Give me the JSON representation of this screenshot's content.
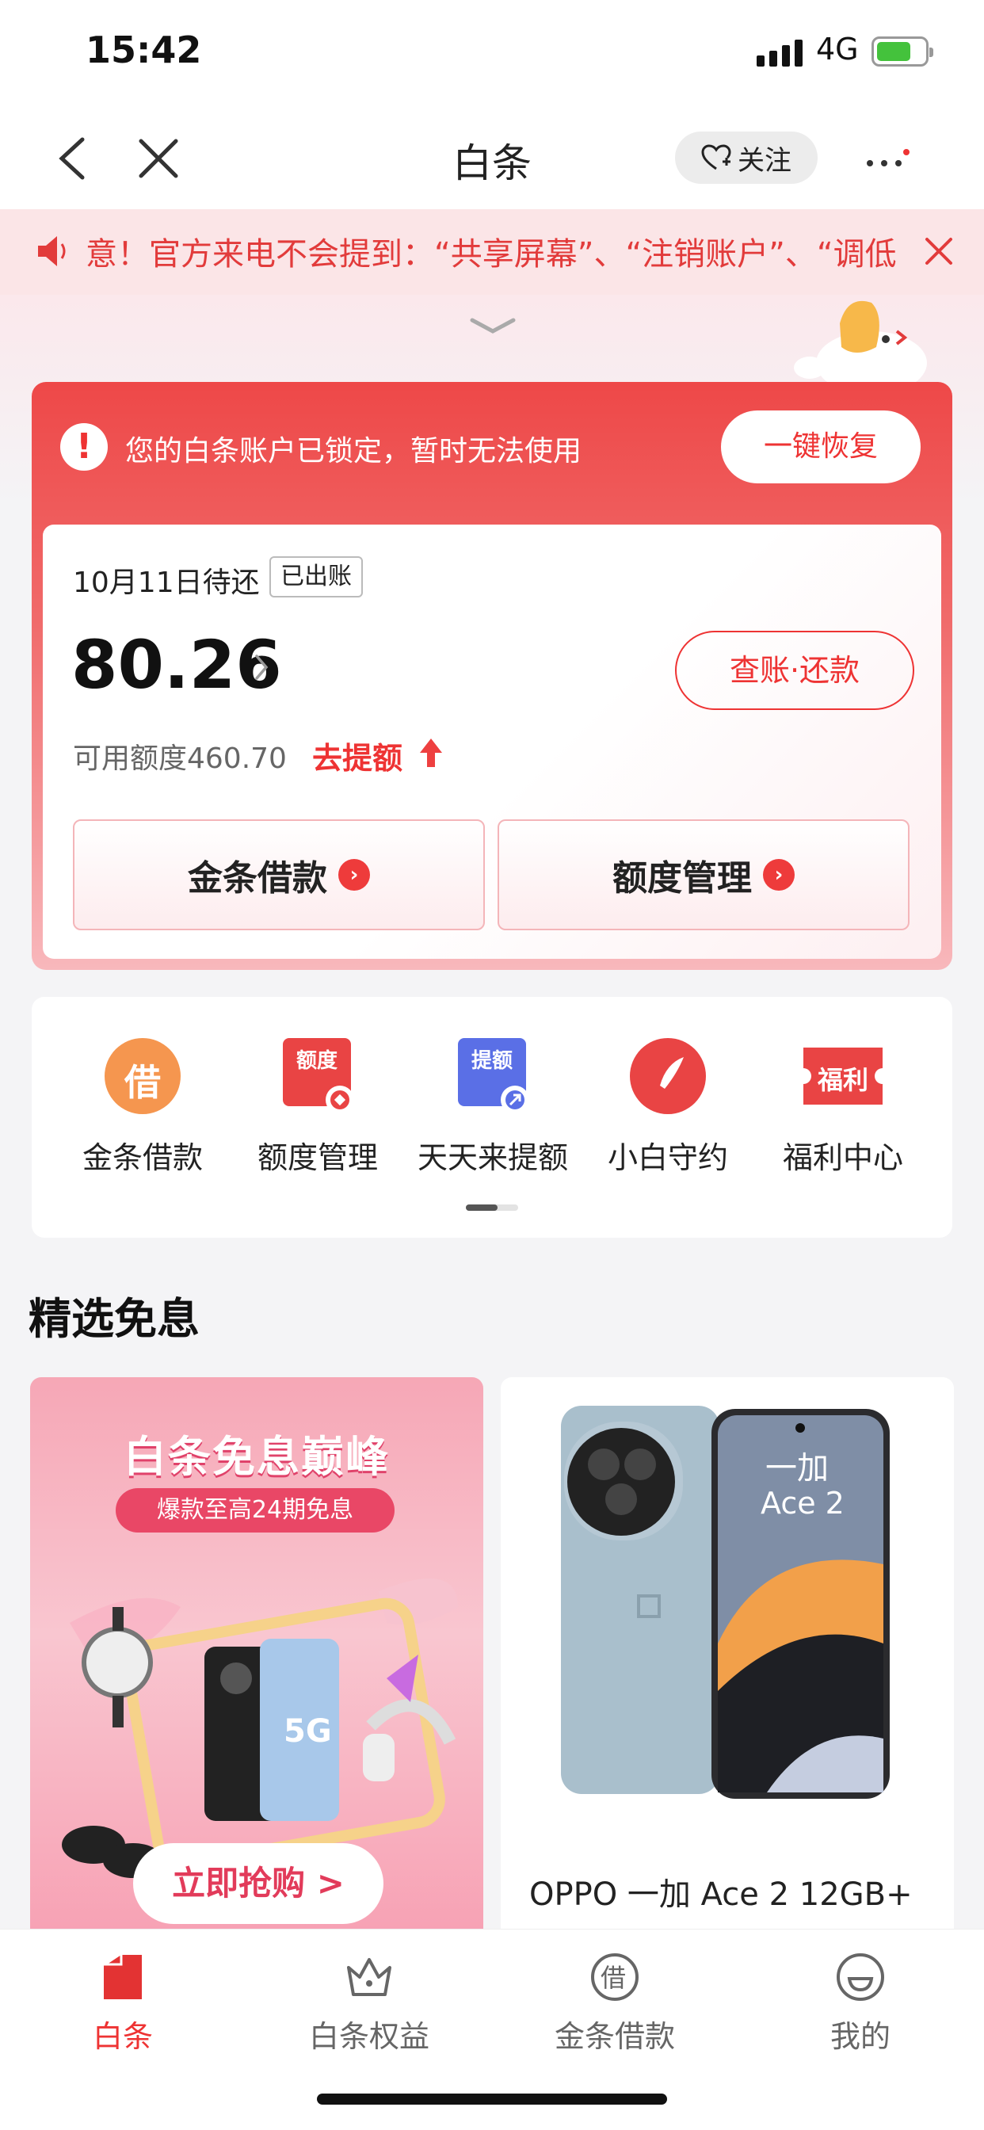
{
  "status": {
    "time": "15:42",
    "network": "4G"
  },
  "nav": {
    "title": "白条",
    "follow_label": "关注"
  },
  "notice": {
    "text": "意！官方来电不会提到：“共享屏幕”、“注销账户”、“调低"
  },
  "account": {
    "lock_message": "您的白条账户已锁定，暂时无法使用",
    "restore_label": "一键恢复",
    "due_label": "10月11日待还",
    "billed_badge": "已出账",
    "amount": "80.26",
    "pay_label": "查账·还款",
    "available": "可用额度460.70",
    "raise_label": "去提额",
    "btn_loan": "金条借款",
    "btn_limit": "额度管理"
  },
  "quick": [
    {
      "label": "金条借款",
      "icon": "loan-icon",
      "glyph": "借"
    },
    {
      "label": "额度管理",
      "icon": "limit-icon",
      "glyph": "额度"
    },
    {
      "label": "天天来提额",
      "icon": "raise-limit-icon",
      "glyph": "提额"
    },
    {
      "label": "小白守约",
      "icon": "credit-gauge-icon",
      "glyph": ""
    },
    {
      "label": "福利中心",
      "icon": "welfare-ticket-icon",
      "glyph": "福利"
    }
  ],
  "section_title": "精选免息",
  "promo": {
    "headline": "白条免息巅峰",
    "subline": "爆款至高24期免息",
    "buy_label": "立即抢购 >",
    "badge_5g": "5G"
  },
  "product": {
    "name": "OPPO 一加 Ace 2 12GB+",
    "screen_text_1": "一加",
    "screen_text_2": "Ace 2"
  },
  "tabs": [
    {
      "label": "白条",
      "active": true
    },
    {
      "label": "白条权益",
      "active": false
    },
    {
      "label": "金条借款",
      "active": false
    },
    {
      "label": "我的",
      "active": false
    }
  ],
  "colors": {
    "accent": "#e33333",
    "notice_bg": "#fbe5e7"
  }
}
